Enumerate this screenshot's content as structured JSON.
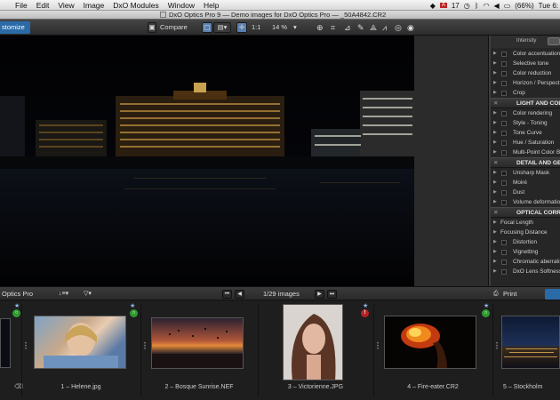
{
  "menubar": {
    "app_icon": "apple-icon",
    "items": [
      "File",
      "Edit",
      "View",
      "Image",
      "DxO Modules",
      "Window",
      "Help"
    ],
    "status": {
      "adobe_count": "17",
      "battery": "(66%)",
      "clock": "Tue 6:"
    }
  },
  "window": {
    "title": "DxO Optics Pro 9 — Demo images for DxO Optics Pro — _50A4842.CR2"
  },
  "toolbar": {
    "customize_label": "stomize",
    "compare_label": "Compare",
    "zoom_1to1": "1:1",
    "zoom_percent": "14 %"
  },
  "panel": {
    "intensity_label": "Intensity",
    "rows": [
      {
        "kind": "row",
        "label": "Color accentuation"
      },
      {
        "kind": "row",
        "label": "Selective tone"
      },
      {
        "kind": "row",
        "label": "Color reduction"
      },
      {
        "kind": "row",
        "label": "Horizon / Perspective"
      },
      {
        "kind": "row",
        "label": "Crop"
      },
      {
        "kind": "head",
        "label": "LIGHT AND COLOR"
      },
      {
        "kind": "row",
        "label": "Color rendering"
      },
      {
        "kind": "row",
        "label": "Style - Toning"
      },
      {
        "kind": "row",
        "label": "Tone Curve"
      },
      {
        "kind": "row",
        "label": "Hue / Saturation"
      },
      {
        "kind": "row",
        "label": "Multi-Point Color Balance"
      },
      {
        "kind": "head",
        "label": "DETAIL AND GEOMETRY"
      },
      {
        "kind": "row",
        "label": "Unsharp Mask"
      },
      {
        "kind": "row",
        "label": "Moiré"
      },
      {
        "kind": "row",
        "label": "Dust"
      },
      {
        "kind": "row",
        "label": "Volume deformation"
      },
      {
        "kind": "head",
        "label": "OPTICAL CORRECTIONS"
      },
      {
        "kind": "sub",
        "label": "Focal Length"
      },
      {
        "kind": "sub",
        "label": "Focusing Distance"
      },
      {
        "kind": "row",
        "label": "Distortion"
      },
      {
        "kind": "row",
        "label": "Vignetting"
      },
      {
        "kind": "row",
        "label": "Chromatic aberration"
      },
      {
        "kind": "row",
        "label": "DxO Lens Softness"
      }
    ]
  },
  "filmstrip_bar": {
    "left_label": "Optics Pro",
    "count_label": "1/29 images",
    "print_label": "Print"
  },
  "filmstrip": {
    "items": [
      {
        "caption": "1 – Helene.jpg",
        "status": "ok"
      },
      {
        "caption": "2 – Bosque Sunrise.NEF",
        "status": "none"
      },
      {
        "caption": "3 – Victorienne.JPG",
        "status": "error"
      },
      {
        "caption": "4 – Fire-eater.CR2",
        "status": "ok"
      },
      {
        "caption": "5 – Stockholm",
        "status": "ok"
      }
    ]
  },
  "colors": {
    "accent_blue": "#2a6aa7",
    "status_ok": "#2e9b2e",
    "status_error": "#b42323",
    "star": "#8fb8e4"
  }
}
